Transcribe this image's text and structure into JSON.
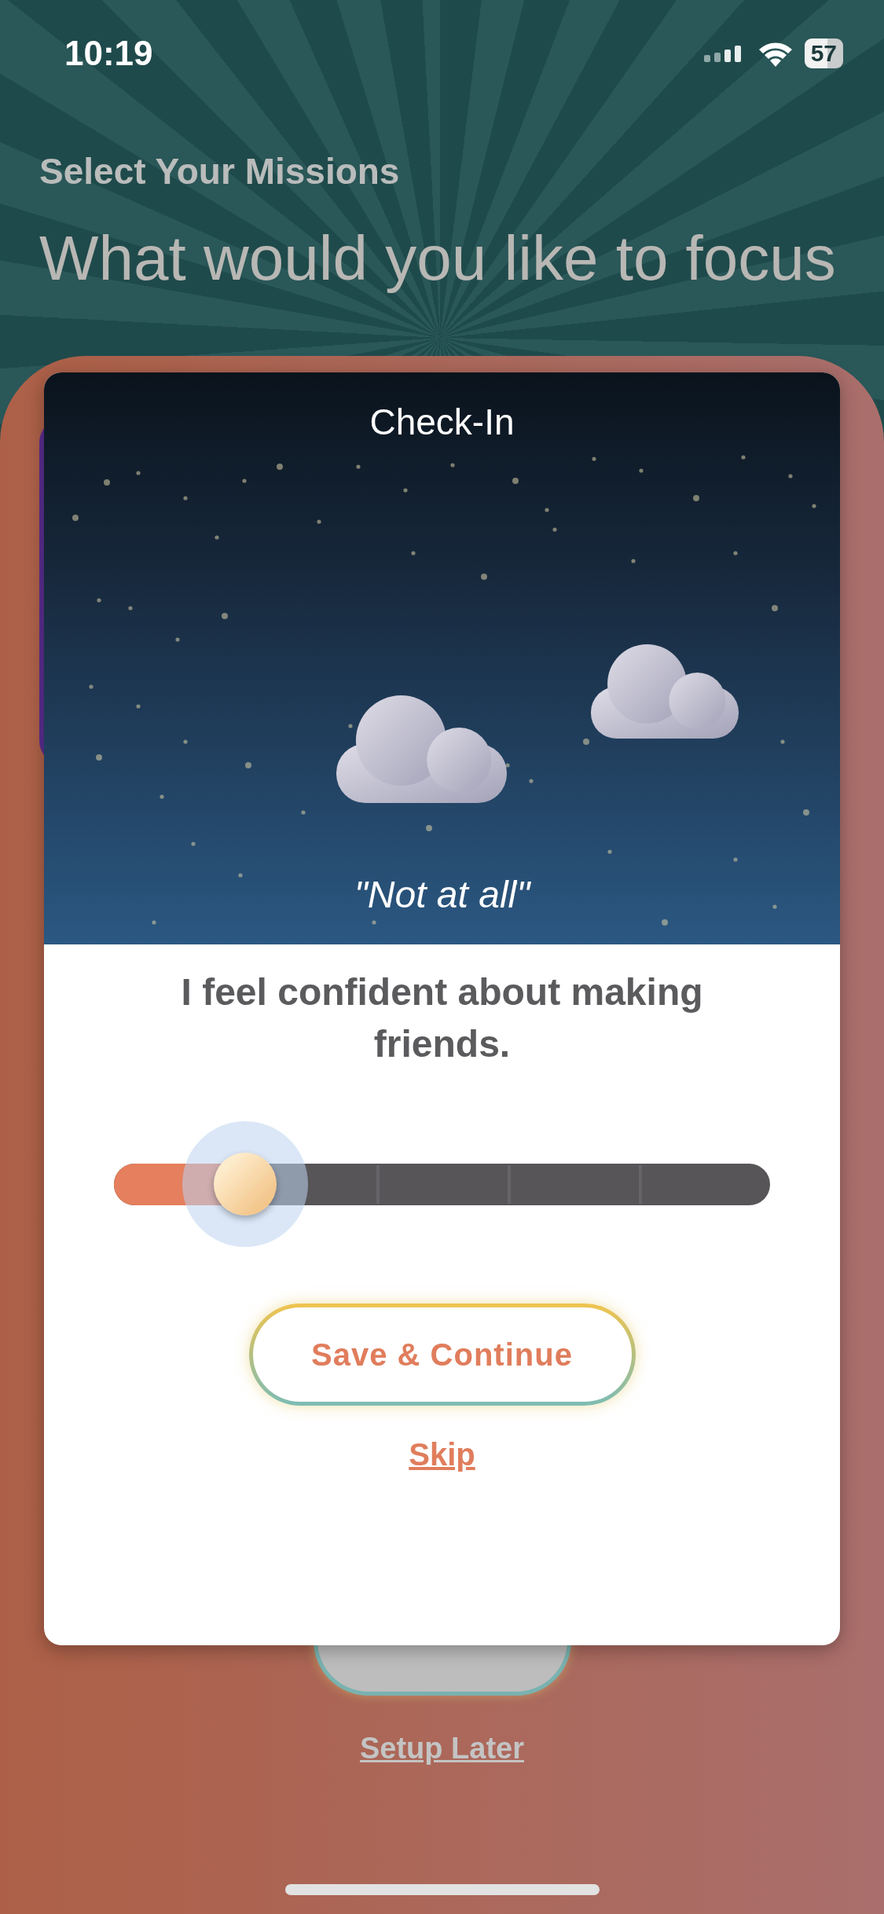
{
  "status_bar": {
    "time": "10:19",
    "battery": "57"
  },
  "screen": {
    "subtitle": "Select Your Missions",
    "title": "What would you like to focus",
    "link": "Setup Later"
  },
  "dialog": {
    "title": "Check-In",
    "rating_label": "\"Not at all\"",
    "question": "I feel confident about making friends.",
    "slider": {
      "level": 0.2
    },
    "primary_button": "Save & Continue",
    "skip_link": "Skip"
  }
}
